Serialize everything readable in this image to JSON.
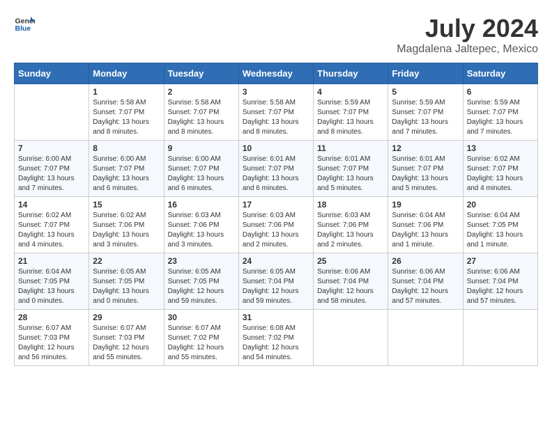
{
  "header": {
    "logo_line1": "General",
    "logo_line2": "Blue",
    "month_year": "July 2024",
    "location": "Magdalena Jaltepec, Mexico"
  },
  "weekdays": [
    "Sunday",
    "Monday",
    "Tuesday",
    "Wednesday",
    "Thursday",
    "Friday",
    "Saturday"
  ],
  "weeks": [
    [
      {
        "day": "",
        "sunrise": "",
        "sunset": "",
        "daylight": ""
      },
      {
        "day": "1",
        "sunrise": "Sunrise: 5:58 AM",
        "sunset": "Sunset: 7:07 PM",
        "daylight": "Daylight: 13 hours and 8 minutes."
      },
      {
        "day": "2",
        "sunrise": "Sunrise: 5:58 AM",
        "sunset": "Sunset: 7:07 PM",
        "daylight": "Daylight: 13 hours and 8 minutes."
      },
      {
        "day": "3",
        "sunrise": "Sunrise: 5:58 AM",
        "sunset": "Sunset: 7:07 PM",
        "daylight": "Daylight: 13 hours and 8 minutes."
      },
      {
        "day": "4",
        "sunrise": "Sunrise: 5:59 AM",
        "sunset": "Sunset: 7:07 PM",
        "daylight": "Daylight: 13 hours and 8 minutes."
      },
      {
        "day": "5",
        "sunrise": "Sunrise: 5:59 AM",
        "sunset": "Sunset: 7:07 PM",
        "daylight": "Daylight: 13 hours and 7 minutes."
      },
      {
        "day": "6",
        "sunrise": "Sunrise: 5:59 AM",
        "sunset": "Sunset: 7:07 PM",
        "daylight": "Daylight: 13 hours and 7 minutes."
      }
    ],
    [
      {
        "day": "7",
        "sunrise": "Sunrise: 6:00 AM",
        "sunset": "Sunset: 7:07 PM",
        "daylight": "Daylight: 13 hours and 7 minutes."
      },
      {
        "day": "8",
        "sunrise": "Sunrise: 6:00 AM",
        "sunset": "Sunset: 7:07 PM",
        "daylight": "Daylight: 13 hours and 6 minutes."
      },
      {
        "day": "9",
        "sunrise": "Sunrise: 6:00 AM",
        "sunset": "Sunset: 7:07 PM",
        "daylight": "Daylight: 13 hours and 6 minutes."
      },
      {
        "day": "10",
        "sunrise": "Sunrise: 6:01 AM",
        "sunset": "Sunset: 7:07 PM",
        "daylight": "Daylight: 13 hours and 6 minutes."
      },
      {
        "day": "11",
        "sunrise": "Sunrise: 6:01 AM",
        "sunset": "Sunset: 7:07 PM",
        "daylight": "Daylight: 13 hours and 5 minutes."
      },
      {
        "day": "12",
        "sunrise": "Sunrise: 6:01 AM",
        "sunset": "Sunset: 7:07 PM",
        "daylight": "Daylight: 13 hours and 5 minutes."
      },
      {
        "day": "13",
        "sunrise": "Sunrise: 6:02 AM",
        "sunset": "Sunset: 7:07 PM",
        "daylight": "Daylight: 13 hours and 4 minutes."
      }
    ],
    [
      {
        "day": "14",
        "sunrise": "Sunrise: 6:02 AM",
        "sunset": "Sunset: 7:07 PM",
        "daylight": "Daylight: 13 hours and 4 minutes."
      },
      {
        "day": "15",
        "sunrise": "Sunrise: 6:02 AM",
        "sunset": "Sunset: 7:06 PM",
        "daylight": "Daylight: 13 hours and 3 minutes."
      },
      {
        "day": "16",
        "sunrise": "Sunrise: 6:03 AM",
        "sunset": "Sunset: 7:06 PM",
        "daylight": "Daylight: 13 hours and 3 minutes."
      },
      {
        "day": "17",
        "sunrise": "Sunrise: 6:03 AM",
        "sunset": "Sunset: 7:06 PM",
        "daylight": "Daylight: 13 hours and 2 minutes."
      },
      {
        "day": "18",
        "sunrise": "Sunrise: 6:03 AM",
        "sunset": "Sunset: 7:06 PM",
        "daylight": "Daylight: 13 hours and 2 minutes."
      },
      {
        "day": "19",
        "sunrise": "Sunrise: 6:04 AM",
        "sunset": "Sunset: 7:06 PM",
        "daylight": "Daylight: 13 hours and 1 minute."
      },
      {
        "day": "20",
        "sunrise": "Sunrise: 6:04 AM",
        "sunset": "Sunset: 7:05 PM",
        "daylight": "Daylight: 13 hours and 1 minute."
      }
    ],
    [
      {
        "day": "21",
        "sunrise": "Sunrise: 6:04 AM",
        "sunset": "Sunset: 7:05 PM",
        "daylight": "Daylight: 13 hours and 0 minutes."
      },
      {
        "day": "22",
        "sunrise": "Sunrise: 6:05 AM",
        "sunset": "Sunset: 7:05 PM",
        "daylight": "Daylight: 13 hours and 0 minutes."
      },
      {
        "day": "23",
        "sunrise": "Sunrise: 6:05 AM",
        "sunset": "Sunset: 7:05 PM",
        "daylight": "Daylight: 12 hours and 59 minutes."
      },
      {
        "day": "24",
        "sunrise": "Sunrise: 6:05 AM",
        "sunset": "Sunset: 7:04 PM",
        "daylight": "Daylight: 12 hours and 59 minutes."
      },
      {
        "day": "25",
        "sunrise": "Sunrise: 6:06 AM",
        "sunset": "Sunset: 7:04 PM",
        "daylight": "Daylight: 12 hours and 58 minutes."
      },
      {
        "day": "26",
        "sunrise": "Sunrise: 6:06 AM",
        "sunset": "Sunset: 7:04 PM",
        "daylight": "Daylight: 12 hours and 57 minutes."
      },
      {
        "day": "27",
        "sunrise": "Sunrise: 6:06 AM",
        "sunset": "Sunset: 7:04 PM",
        "daylight": "Daylight: 12 hours and 57 minutes."
      }
    ],
    [
      {
        "day": "28",
        "sunrise": "Sunrise: 6:07 AM",
        "sunset": "Sunset: 7:03 PM",
        "daylight": "Daylight: 12 hours and 56 minutes."
      },
      {
        "day": "29",
        "sunrise": "Sunrise: 6:07 AM",
        "sunset": "Sunset: 7:03 PM",
        "daylight": "Daylight: 12 hours and 55 minutes."
      },
      {
        "day": "30",
        "sunrise": "Sunrise: 6:07 AM",
        "sunset": "Sunset: 7:02 PM",
        "daylight": "Daylight: 12 hours and 55 minutes."
      },
      {
        "day": "31",
        "sunrise": "Sunrise: 6:08 AM",
        "sunset": "Sunset: 7:02 PM",
        "daylight": "Daylight: 12 hours and 54 minutes."
      },
      {
        "day": "",
        "sunrise": "",
        "sunset": "",
        "daylight": ""
      },
      {
        "day": "",
        "sunrise": "",
        "sunset": "",
        "daylight": ""
      },
      {
        "day": "",
        "sunrise": "",
        "sunset": "",
        "daylight": ""
      }
    ]
  ]
}
